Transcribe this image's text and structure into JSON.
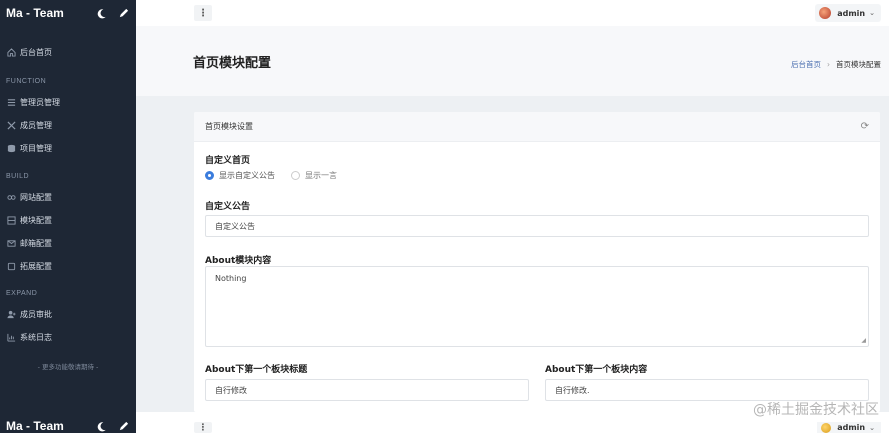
{
  "app": {
    "title": "Ma - Team",
    "footer_title": "Ma - Team"
  },
  "sidebar": {
    "home": "后台首页",
    "sections": {
      "function": "FUNCTION",
      "build": "BUILD",
      "expand": "EXPAND"
    },
    "items": {
      "admin_manage": "管理员管理",
      "member_manage": "成员管理",
      "project_manage": "项目管理",
      "site_config": "网站配置",
      "module_config": "模块配置",
      "mail_config": "邮箱配置",
      "extend_config": "拓展配置",
      "member_review": "成员审批",
      "system_log": "系统日志"
    },
    "more": "- 更多功能敬请期待 -"
  },
  "topbar": {
    "menu_glyph": "⋮",
    "user": "admin"
  },
  "header": {
    "page_title": "首页模块配置",
    "breadcrumb_home": "后台首页",
    "breadcrumb_current": "首页模块配置"
  },
  "card": {
    "title": "首页模块设置",
    "custom_home_label": "自定义首页",
    "radio_custom": "显示自定义公告",
    "radio_quote": "显示一言",
    "custom_notice_label": "自定义公告",
    "custom_notice_value": "自定义公告",
    "about_label": "About模块内容",
    "about_value": "Nothing",
    "first_title_label": "About下第一个板块标题",
    "first_title_value": "自行修改",
    "first_content_label": "About下第一个板块内容",
    "first_content_value": "自行修改."
  },
  "bottom": {
    "user": "admin"
  },
  "watermark": "@稀土掘金技术社区",
  "colors": {
    "sidebar_bg": "#1e2735",
    "accent": "#3b7ddd"
  }
}
